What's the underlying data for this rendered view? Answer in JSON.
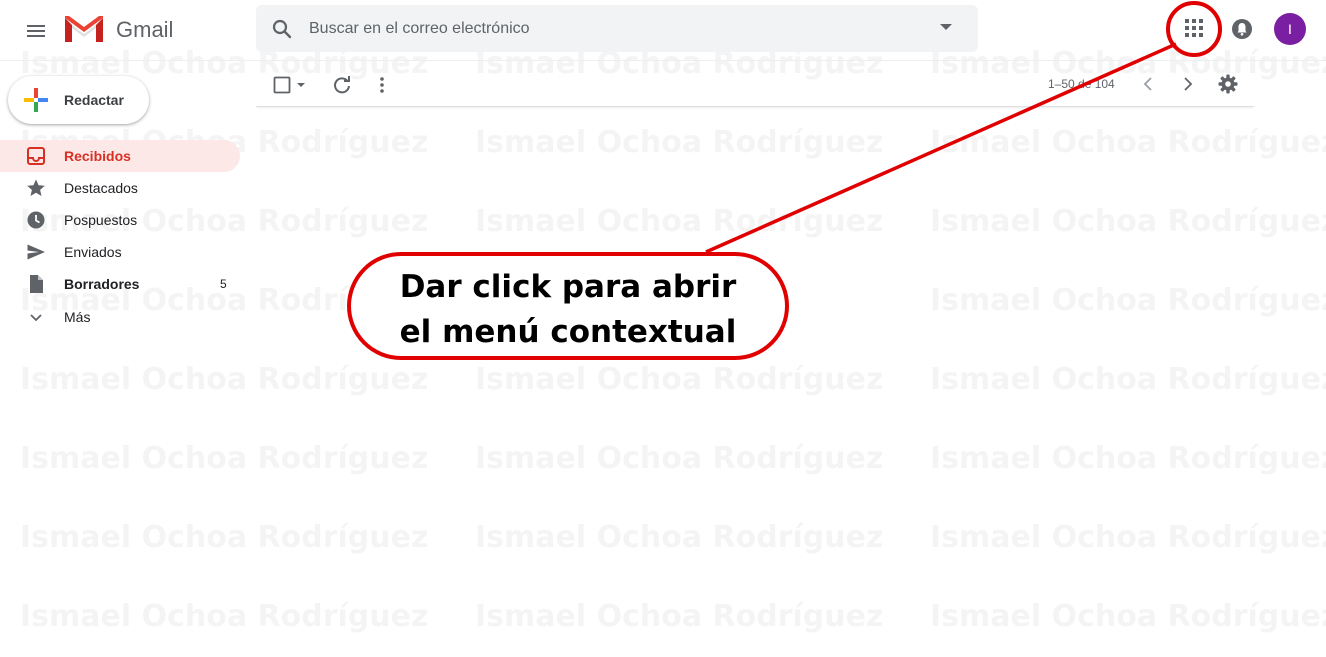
{
  "app": {
    "name": "Gmail",
    "account_initial": "I",
    "accent_color": "#d93025",
    "avatar_color": "#7b1fa2"
  },
  "search": {
    "placeholder": "Buscar en el correo electrónico"
  },
  "compose": {
    "label": "Redactar"
  },
  "sidebar": {
    "items": [
      {
        "label": "Recibidos",
        "icon": "inbox-icon",
        "active": true,
        "count": ""
      },
      {
        "label": "Destacados",
        "icon": "star-icon",
        "active": false,
        "count": ""
      },
      {
        "label": "Pospuestos",
        "icon": "clock-icon",
        "active": false,
        "count": ""
      },
      {
        "label": "Enviados",
        "icon": "send-icon",
        "active": false,
        "count": ""
      },
      {
        "label": "Borradores",
        "icon": "draft-icon",
        "active": false,
        "count": "5"
      },
      {
        "label": "Más",
        "icon": "chevron-down-icon",
        "active": false,
        "count": ""
      }
    ]
  },
  "toolbar": {
    "pagination": "1–50 de 104"
  },
  "watermark": {
    "text": "Ismael Ochoa Rodríguez"
  },
  "callout": {
    "line1": "Dar click para abrir",
    "line2": "el menú contextual",
    "color": "#e00000"
  }
}
